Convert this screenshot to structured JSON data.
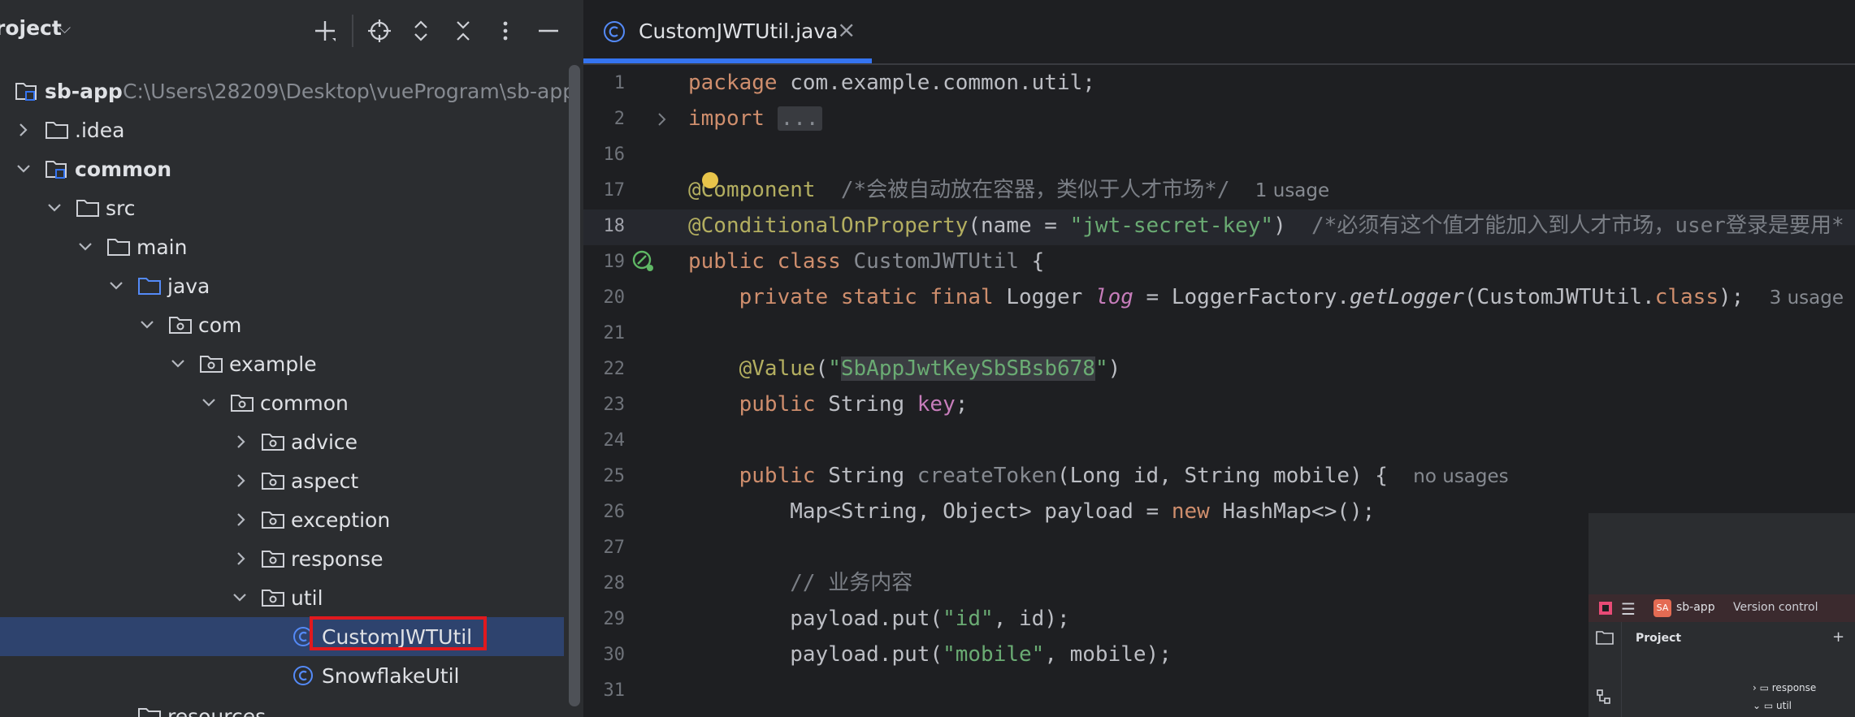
{
  "project_panel": {
    "title": "roject",
    "tree": [
      {
        "label": "sb-app",
        "path": "C:\\Users\\28209\\Desktop\\vueProgram\\sb-app",
        "kind": "module",
        "bold": true
      },
      {
        "label": ".idea",
        "kind": "folder"
      },
      {
        "label": "common",
        "kind": "module",
        "bold": true
      },
      {
        "label": "src",
        "kind": "folder"
      },
      {
        "label": "main",
        "kind": "folder"
      },
      {
        "label": "java",
        "kind": "source-folder"
      },
      {
        "label": "com",
        "kind": "package"
      },
      {
        "label": "example",
        "kind": "package"
      },
      {
        "label": "common",
        "kind": "package"
      },
      {
        "label": "advice",
        "kind": "package"
      },
      {
        "label": "aspect",
        "kind": "package"
      },
      {
        "label": "exception",
        "kind": "package"
      },
      {
        "label": "response",
        "kind": "package"
      },
      {
        "label": "util",
        "kind": "package"
      },
      {
        "label": "CustomJWTUtil",
        "kind": "class",
        "selected": true
      },
      {
        "label": "SnowflakeUtil",
        "kind": "class"
      },
      {
        "label": "resources",
        "kind": "folder"
      }
    ]
  },
  "editor": {
    "tab": {
      "label": "CustomJWTUtil.java",
      "close": "×"
    },
    "line_numbers": [
      "1",
      "2",
      "16",
      "17",
      "18",
      "19",
      "20",
      "21",
      "22",
      "23",
      "24",
      "25",
      "26",
      "27",
      "28",
      "29",
      "30",
      "31"
    ],
    "current_line": "18",
    "code": {
      "l1_kw": "package",
      "l1_rest": " com.example.common.util;",
      "l2_kw": "import",
      "l2_fold": "...",
      "l17_ann": "@Component",
      "l17_cmt": "/*会被自动放在容器，类似于人才市场*/",
      "l17_hint": "1 usage",
      "l18_ann": "@ConditionalOnProperty",
      "l18_a": "(name = ",
      "l18_str": "\"jwt-secret-key\"",
      "l18_b": ")",
      "l18_cmt": "/*必须有这个值才能加入到人才市场，user登录是要用*",
      "l19_kw": "public class",
      "l19_cls": "CustomJWTUtil",
      "l19_b": " {",
      "l20_kw": "private static final",
      "l20_a": " Logger ",
      "l20_fld": "log",
      "l20_b": " = LoggerFactory.",
      "l20_fn": "getLogger",
      "l20_c": "(CustomJWTUtil.",
      "l20_kw2": "class",
      "l20_d": ");",
      "l20_hint": "3 usage",
      "l22_ann": "@Value",
      "l22_a": "(",
      "l22_q1": "\"",
      "l22_str": "SbAppJwtKeySbSBsb678",
      "l22_q2": "\"",
      "l22_b": ")",
      "l23_kw": "public",
      "l23_a": " String ",
      "l23_fld": "key",
      "l23_b": ";",
      "l25_kw": "public",
      "l25_a": " String ",
      "l25_fn": "createToken",
      "l25_b": "(Long id, String mobile) {",
      "l25_hint": "no usages",
      "l26_a": "Map<String, Object> payload = ",
      "l26_kw": "new",
      "l26_b": " HashMap<>();",
      "l28_cmt": "// 业务内容",
      "l29_a": "payload.put(",
      "l29_str": "\"id\"",
      "l29_b": ", id);",
      "l30_a": "payload.put(",
      "l30_str": "\"mobile\"",
      "l30_b": ", mobile);"
    }
  },
  "mini_window": {
    "project_badge": "SA",
    "project_name": "sb-app",
    "vcs": "Version control",
    "panel_title": "Project",
    "items": [
      "response",
      "util"
    ]
  },
  "colors": {
    "accent": "#3574f0",
    "selection": "#2e436e",
    "highlight_box": "#e0191e"
  }
}
